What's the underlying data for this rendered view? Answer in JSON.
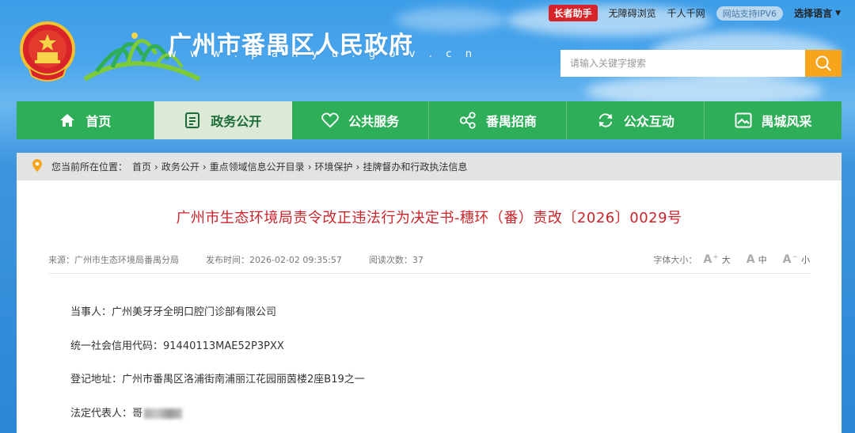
{
  "topbar": {
    "elder_mode": "长者助手",
    "accessible": "无障碍浏览",
    "network": "千人千网",
    "ipv6": "网站支持IPV6",
    "language": "选择语言"
  },
  "header": {
    "site_title": "广州市番禺区人民政府",
    "site_url": "w w w . p a n y u . g o v . c n"
  },
  "search": {
    "placeholder": "请输入关键字搜索"
  },
  "nav": {
    "items": [
      {
        "label": "首页",
        "icon": "home-icon"
      },
      {
        "label": "政务公开",
        "icon": "document-icon"
      },
      {
        "label": "公共服务",
        "icon": "heart-icon"
      },
      {
        "label": "番禺招商",
        "icon": "share-icon"
      },
      {
        "label": "公众互动",
        "icon": "refresh-icon"
      },
      {
        "label": "禺城风采",
        "icon": "picture-icon"
      }
    ],
    "active_color": "#dbe9d6",
    "color": "#2eae59"
  },
  "breadcrumb": {
    "label": "您当前所在位置：",
    "items": [
      "首页",
      "政务公开",
      "重点领域信息公开目录",
      "环境保护",
      "挂牌督办和行政执法信息"
    ]
  },
  "article": {
    "title": "广州市生态环境局责令改正违法行为决定书-穗环（番）责改〔2026〕0029号",
    "source": "来源：广州市生态环境局番禺分局",
    "published": "发布时间：2026-02-02 09:35:57",
    "views": "阅读次数：37",
    "font_size_label": "字体大小：",
    "font_large": "大",
    "font_medium": "中",
    "font_small": "小",
    "paragraphs": [
      "当事人：广州美牙牙全明口腔门诊部有限公司",
      "统一社会信用代码：91440113MAE52P3PXX",
      "登记地址：广州市番禺区洛浦街南浦丽江花园丽茵楼2座B19之一",
      "法定代表人：哥"
    ]
  },
  "colors": {
    "accent_red": "#c9242b",
    "search_button": "#f6a51c",
    "elder_button": "#d8232a"
  }
}
